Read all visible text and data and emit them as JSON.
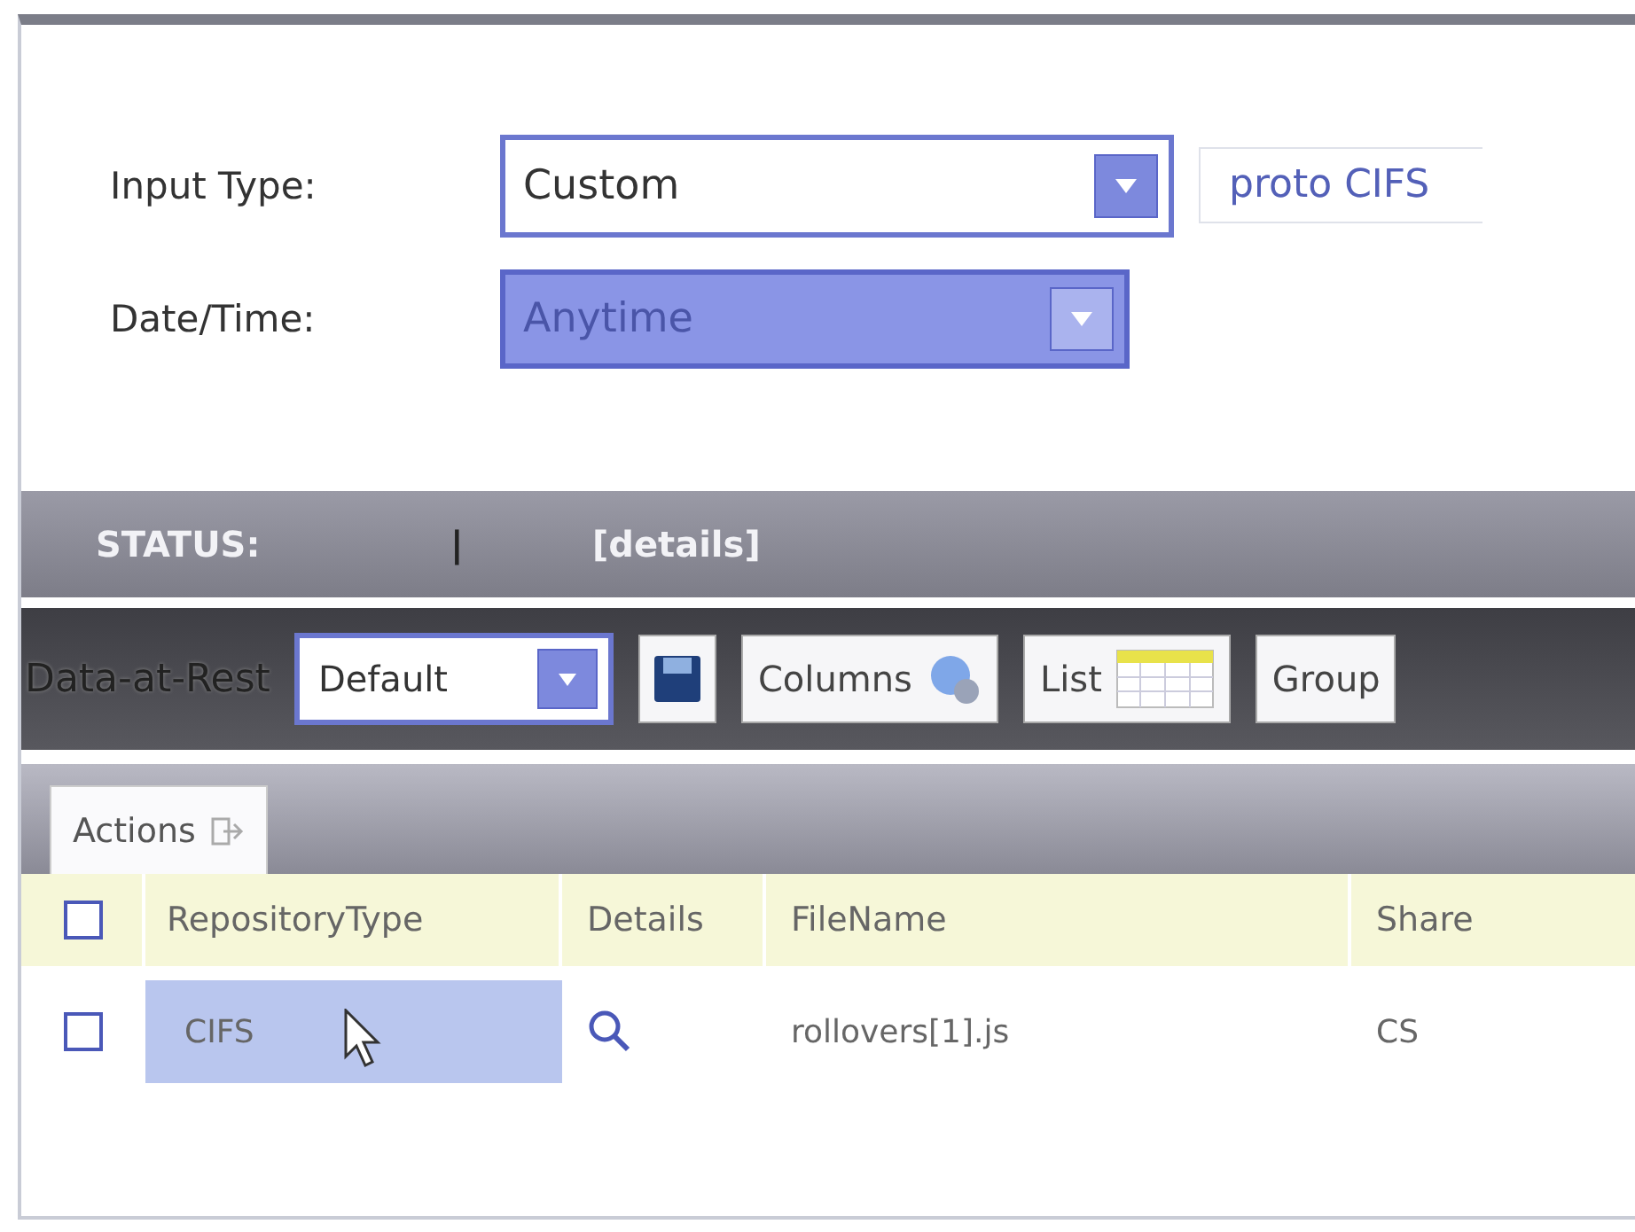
{
  "form": {
    "fields": [
      {
        "label": "Input Type:",
        "value": "Custom",
        "highlighted": false,
        "extra": "proto CIFS"
      },
      {
        "label": "Date/Time:",
        "value": "Anytime",
        "highlighted": true
      }
    ]
  },
  "status_bar": {
    "label": "STATUS:",
    "separator": "|",
    "details": "[details]"
  },
  "toolbar": {
    "title": "Data-at-Rest",
    "view": {
      "value": "Default"
    },
    "buttons": [
      {
        "kind": "save"
      },
      {
        "kind": "columns",
        "label": "Columns"
      },
      {
        "kind": "list",
        "label": "List"
      },
      {
        "kind": "group",
        "label": "Group"
      }
    ]
  },
  "actions": {
    "label": "Actions"
  },
  "table": {
    "header_checked": false,
    "columns": [
      "RepositoryType",
      "Details",
      "FileName",
      "Share"
    ],
    "rows": [
      {
        "checked": false,
        "repository_type": "CIFS",
        "highlighted": true,
        "file_name": "rollovers[1].js",
        "share": "CS"
      }
    ]
  }
}
